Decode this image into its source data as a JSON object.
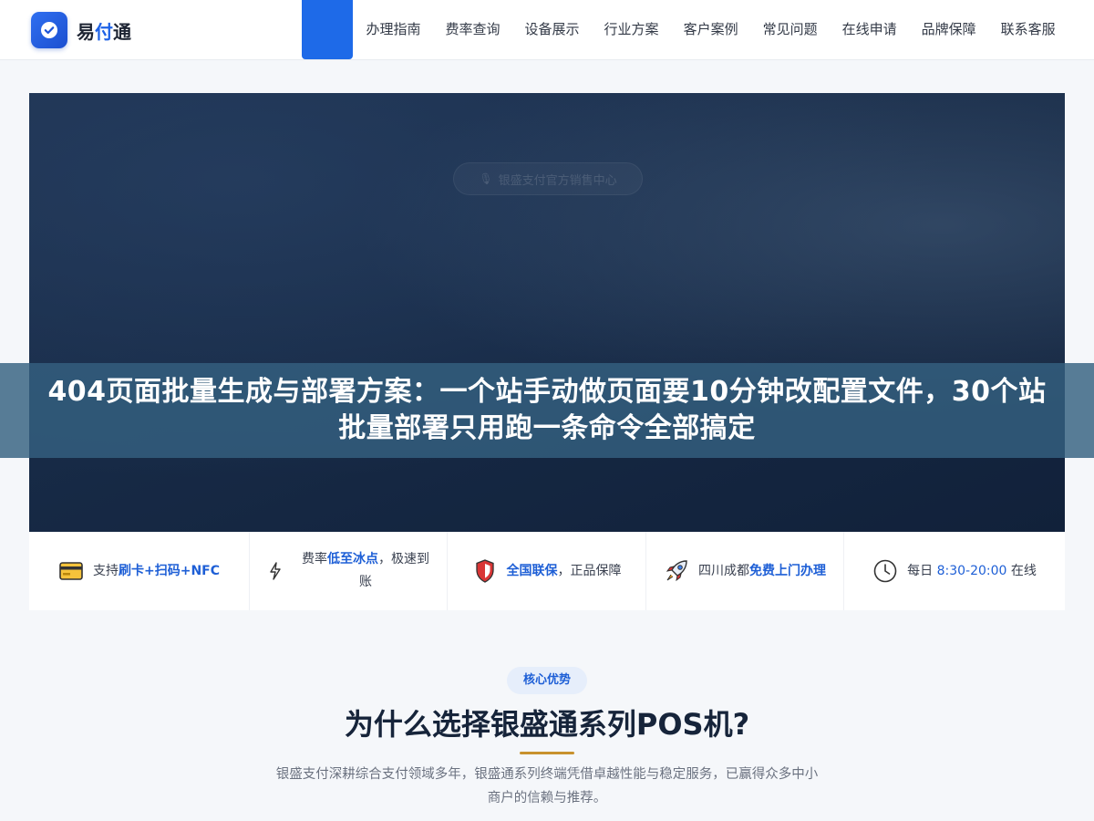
{
  "header": {
    "logo_text_a": "易",
    "logo_text_b": "付",
    "logo_text_c": "通",
    "nav": [
      "办理指南",
      "费率查询",
      "设备展示",
      "行业方案",
      "客户案例",
      "常见问题",
      "在线申请",
      "品牌保障",
      "联系客服"
    ]
  },
  "hero": {
    "pill_text": "银盛支付官方销售中心",
    "title": "404页面批量生成与部署方案：一个站手动做页面要10分钟改配置文件，30个站批量部署只用跑一条命令全部搞定"
  },
  "features": {
    "f1": {
      "pre": "支持",
      "hl": "刷卡+扫码+NFC"
    },
    "f2": {
      "pre": "费率",
      "hl": "低至冰点",
      "post": "，极速到账"
    },
    "f3": {
      "hl": "全国联保",
      "post": "，正品保障"
    },
    "f4": {
      "pre": "四川成都",
      "hl": "免费上门办理"
    },
    "f5": {
      "pre": "每日 ",
      "hl": "8:30-20:00",
      "post": " 在线"
    }
  },
  "section": {
    "tag": "核心优势",
    "title": "为什么选择银盛通系列POS机?",
    "desc": "银盛支付深耕综合支付领域多年，银盛通系列终端凭借卓越性能与稳定服务，已赢得众多中小商户的信赖与推荐。"
  },
  "colors": {
    "brand": "#1e6ae8",
    "accent_gold": "#c8922e",
    "hero_dark": "#172a46",
    "banner": "#346080"
  }
}
